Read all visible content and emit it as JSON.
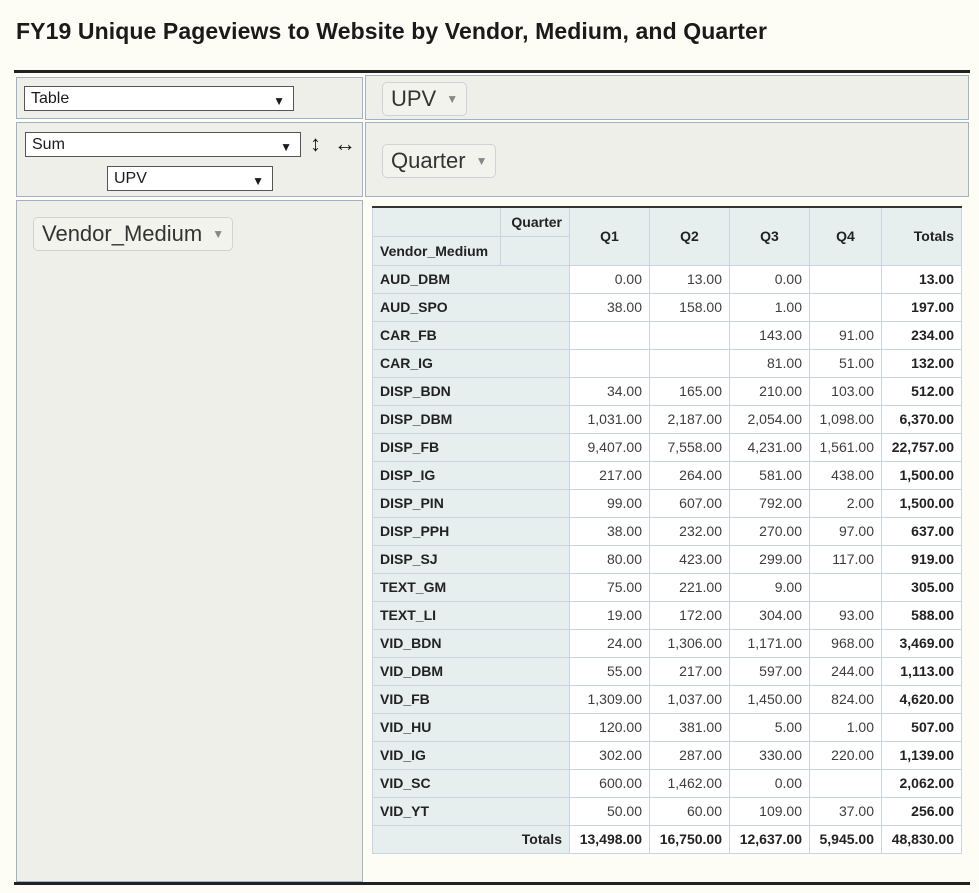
{
  "title": "FY19 Unique Pageviews to Website by Vendor, Medium, and Quarter",
  "controls": {
    "renderer": "Table",
    "aggregator": "Sum",
    "aggregator_field": "UPV",
    "sort_rows_icon": "↕",
    "sort_cols_icon": "↔",
    "unused_attr": "UPV",
    "col_attr": "Quarter",
    "row_attr": "Vendor_Medium",
    "dropdown_arrow": "▼",
    "pill_arrow": "▼"
  },
  "table": {
    "col_attr_label": "Quarter",
    "row_attr_label": "Vendor_Medium",
    "columns": [
      "Q1",
      "Q2",
      "Q3",
      "Q4"
    ],
    "totals_label": "Totals",
    "rows": [
      {
        "label": "AUD_DBM",
        "values": [
          "0.00",
          "13.00",
          "0.00",
          ""
        ],
        "total": "13.00"
      },
      {
        "label": "AUD_SPO",
        "values": [
          "38.00",
          "158.00",
          "1.00",
          ""
        ],
        "total": "197.00"
      },
      {
        "label": "CAR_FB",
        "values": [
          "",
          "",
          "143.00",
          "91.00"
        ],
        "total": "234.00"
      },
      {
        "label": "CAR_IG",
        "values": [
          "",
          "",
          "81.00",
          "51.00"
        ],
        "total": "132.00"
      },
      {
        "label": "DISP_BDN",
        "values": [
          "34.00",
          "165.00",
          "210.00",
          "103.00"
        ],
        "total": "512.00"
      },
      {
        "label": "DISP_DBM",
        "values": [
          "1,031.00",
          "2,187.00",
          "2,054.00",
          "1,098.00"
        ],
        "total": "6,370.00"
      },
      {
        "label": "DISP_FB",
        "values": [
          "9,407.00",
          "7,558.00",
          "4,231.00",
          "1,561.00"
        ],
        "total": "22,757.00"
      },
      {
        "label": "DISP_IG",
        "values": [
          "217.00",
          "264.00",
          "581.00",
          "438.00"
        ],
        "total": "1,500.00"
      },
      {
        "label": "DISP_PIN",
        "values": [
          "99.00",
          "607.00",
          "792.00",
          "2.00"
        ],
        "total": "1,500.00"
      },
      {
        "label": "DISP_PPH",
        "values": [
          "38.00",
          "232.00",
          "270.00",
          "97.00"
        ],
        "total": "637.00"
      },
      {
        "label": "DISP_SJ",
        "values": [
          "80.00",
          "423.00",
          "299.00",
          "117.00"
        ],
        "total": "919.00"
      },
      {
        "label": "TEXT_GM",
        "values": [
          "75.00",
          "221.00",
          "9.00",
          ""
        ],
        "total": "305.00"
      },
      {
        "label": "TEXT_LI",
        "values": [
          "19.00",
          "172.00",
          "304.00",
          "93.00"
        ],
        "total": "588.00"
      },
      {
        "label": "VID_BDN",
        "values": [
          "24.00",
          "1,306.00",
          "1,171.00",
          "968.00"
        ],
        "total": "3,469.00"
      },
      {
        "label": "VID_DBM",
        "values": [
          "55.00",
          "217.00",
          "597.00",
          "244.00"
        ],
        "total": "1,113.00"
      },
      {
        "label": "VID_FB",
        "values": [
          "1,309.00",
          "1,037.00",
          "1,450.00",
          "824.00"
        ],
        "total": "4,620.00"
      },
      {
        "label": "VID_HU",
        "values": [
          "120.00",
          "381.00",
          "5.00",
          "1.00"
        ],
        "total": "507.00"
      },
      {
        "label": "VID_IG",
        "values": [
          "302.00",
          "287.00",
          "330.00",
          "220.00"
        ],
        "total": "1,139.00"
      },
      {
        "label": "VID_SC",
        "values": [
          "600.00",
          "1,462.00",
          "0.00",
          ""
        ],
        "total": "2,062.00"
      },
      {
        "label": "VID_YT",
        "values": [
          "50.00",
          "60.00",
          "109.00",
          "37.00"
        ],
        "total": "256.00"
      }
    ],
    "col_totals": [
      "13,498.00",
      "16,750.00",
      "12,637.00",
      "5,945.00"
    ],
    "grand_total": "48,830.00"
  }
}
